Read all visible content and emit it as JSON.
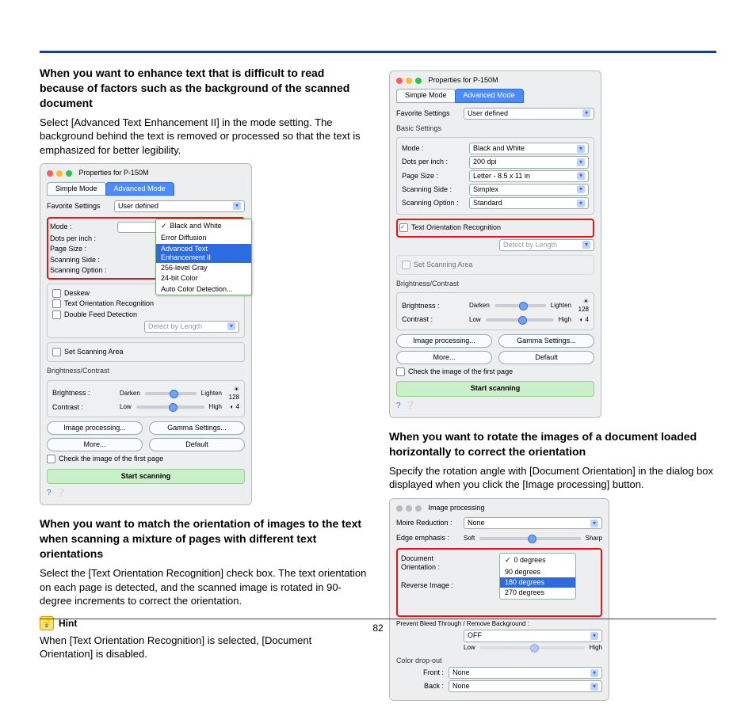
{
  "page_number": "82",
  "col1": {
    "h1": "When you want to enhance text that is difficult to read because of factors such as the background of the scanned document",
    "p1": "Select [Advanced Text Enhancement II] in the mode setting. The background behind the text is removed or processed so that the text is emphasized for better legibility.",
    "h2": "When you want to match the orientation of images to the text when scanning a mixture of pages with different text orientations",
    "p2": "Select the [Text Orientation Recognition] check box. The text orientation on each page is detected, and the scanned image is rotated in 90-degree increments to correct the orientation.",
    "hint_label": "Hint",
    "hint_text": "When [Text Orientation Recognition] is selected, [Document Orientation] is disabled."
  },
  "col2": {
    "h1": "When you want to rotate the images of a document loaded horizontally to correct the orientation",
    "p1": "Specify the rotation angle with [Document Orientation] in the dialog box displayed when you click the [Image processing] button."
  },
  "dlg": {
    "title": "Properties for P-150M",
    "tab_simple": "Simple Mode",
    "tab_adv": "Advanced Mode",
    "fav_label": "Favorite Settings",
    "fav_value": "User defined",
    "basic_label": "Basic Settings",
    "mode_label": "Mode :",
    "mode_value": "Black and White",
    "dpi_label": "Dots per inch :",
    "dpi_value": "200 dpi",
    "page_label": "Page Size :",
    "page_value": "Letter - 8.5 x 11 in",
    "side_label": "Scanning Side :",
    "side_value": "Simplex",
    "opt_label": "Scanning Option :",
    "opt_value": "Standard",
    "mode_menu": [
      "Black and White",
      "Error Diffusion",
      "Advanced Text Enhancement II",
      "256-level Gray",
      "24-bit Color",
      "Auto Color Detection..."
    ],
    "chk_deskew": "Deskew",
    "chk_tor": "Text Orientation Recognition",
    "chk_dfd": "Double Feed Detection",
    "detect_len": "Detect by Length",
    "chk_area": "Set Scanning Area",
    "bc_label": "Brightness/Contrast",
    "bright_label": "Brightness :",
    "darken": "Darken",
    "lighten": "Lighten",
    "bright_val": "128",
    "contrast_label": "Contrast :",
    "low": "Low",
    "high": "High",
    "contrast_val": "4",
    "btn_ip": "Image processing...",
    "btn_gamma": "Gamma Settings...",
    "btn_more": "More...",
    "btn_default": "Default",
    "chk_first": "Check the image of the first page",
    "start": "Start scanning"
  },
  "ip": {
    "title": "Image processing",
    "moire_label": "Moire Reduction :",
    "moire_value": "None",
    "edge_label": "Edge emphasis :",
    "soft": "Soft",
    "sharp": "Sharp",
    "doc_label": "Document Orientation :",
    "rev_label": "Reverse Image :",
    "menu": [
      "0 degrees",
      "90 degrees",
      "180 degrees",
      "270 degrees"
    ],
    "prevent_label": "Prevent Bleed Through / Remove Background :",
    "off": "OFF",
    "drop_label": "Color drop-out",
    "front_label": "Front :",
    "back_label": "Back :",
    "none": "None"
  }
}
